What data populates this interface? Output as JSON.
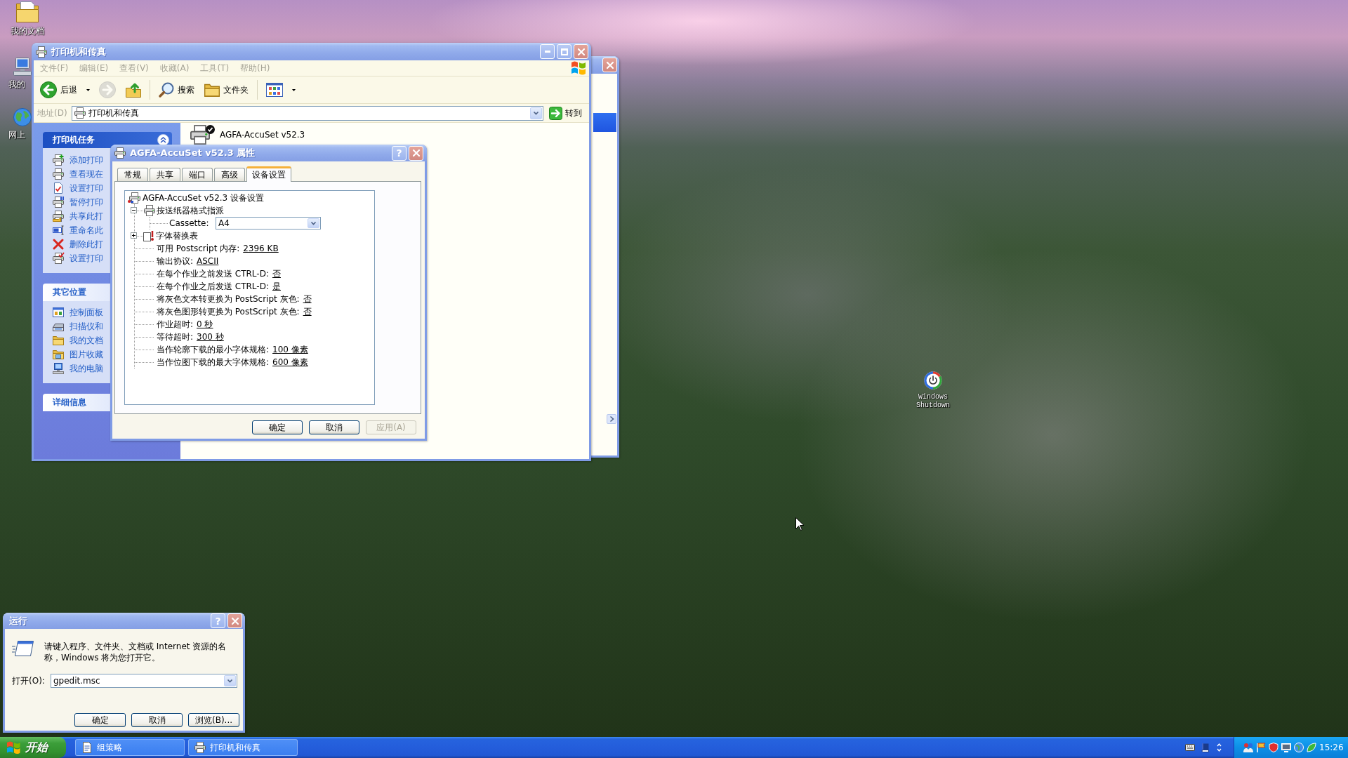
{
  "desktop": {
    "icons": [
      {
        "kind": "documents",
        "label": "我的文档"
      },
      {
        "kind": "computer",
        "label": "我的"
      },
      {
        "kind": "network",
        "label": "网上"
      },
      {
        "kind": "shutdown",
        "label": "Windows Shutdown"
      }
    ]
  },
  "printers_window": {
    "title": "打印机和传真",
    "active": false,
    "menu": [
      "文件(F)",
      "编辑(E)",
      "查看(V)",
      "收藏(A)",
      "工具(T)",
      "帮助(H)"
    ],
    "toolbar": [
      [
        {
          "kind": "back",
          "label": "后退",
          "disabled": false
        },
        {
          "kind": "forward",
          "disabled": true
        },
        {
          "kind": "up",
          "disabled": false
        }
      ],
      [
        {
          "kind": "search",
          "label": "搜索",
          "disabled": false
        },
        {
          "kind": "folders",
          "label": "文件夹",
          "disabled": false
        }
      ],
      [
        {
          "kind": "views",
          "disabled": false
        }
      ]
    ],
    "address": {
      "label": "地址(D)",
      "value": "打印机和传真",
      "go": "转到"
    },
    "sidebar": [
      {
        "kind": "special",
        "title": "打印机任务",
        "expanded": true,
        "items": [
          {
            "kind": "add",
            "label": "添加打印"
          },
          {
            "kind": "queue",
            "label": "查看现在"
          },
          {
            "kind": "document",
            "label": "设置打印"
          },
          {
            "kind": "pause",
            "label": "暂停打印"
          },
          {
            "kind": "share",
            "label": "共享此打"
          },
          {
            "kind": "rename",
            "label": "重命名此"
          },
          {
            "kind": "delete",
            "label": "删除此打"
          },
          {
            "kind": "printer",
            "label": "设置打印"
          }
        ]
      },
      {
        "kind": "normal",
        "title": "其它位置",
        "items": [
          {
            "kind": "panel",
            "label": "控制面板"
          },
          {
            "kind": "scanner",
            "label": "扫描仪和"
          },
          {
            "kind": "folder",
            "label": "我的文档"
          },
          {
            "kind": "pictures",
            "label": "图片收藏"
          },
          {
            "kind": "computer",
            "label": "我的电脑"
          }
        ]
      },
      {
        "kind": "normal",
        "title": "详细信息"
      }
    ],
    "printers": [
      {
        "name": "AGFA-AccuSet v52.3",
        "default": true
      }
    ]
  },
  "properties_dialog": {
    "title": "AGFA-AccuSet v52.3 属性",
    "active": false,
    "help_button": "?",
    "tabs": [
      {
        "label": "常规",
        "selected": false
      },
      {
        "label": "共享",
        "selected": false
      },
      {
        "label": "端口",
        "selected": false
      },
      {
        "label": "高级",
        "selected": false
      },
      {
        "label": "设备设置",
        "selected": true
      }
    ],
    "tree": {
      "label": "AGFA-AccuSet v52.3 设备设置",
      "children": [
        {
          "kind": "tray",
          "label": "按送纸器格式指派",
          "expanded": true,
          "children": [
            {
              "kind": "combo",
              "label": "Cassette:",
              "value": "A4"
            }
          ]
        },
        {
          "kind": "fonts",
          "label": "字体替换表",
          "expanded": false
        },
        {
          "kind": "setting",
          "label": "可用 Postscript 内存:",
          "value": "2396 KB"
        },
        {
          "kind": "setting",
          "label": "输出协议:",
          "value": "ASCII"
        },
        {
          "kind": "setting",
          "label": "在每个作业之前发送 CTRL-D:",
          "value": "否"
        },
        {
          "kind": "setting",
          "label": "在每个作业之后发送 CTRL-D:",
          "value": "是"
        },
        {
          "kind": "setting",
          "label": "将灰色文本转更换为 PostScript 灰色:",
          "value": "否"
        },
        {
          "kind": "setting",
          "label": "将灰色图形转更换为 PostScript 灰色:",
          "value": "否"
        },
        {
          "kind": "setting",
          "label": "作业超时:",
          "value": "0 秒"
        },
        {
          "kind": "setting",
          "label": "等待超时:",
          "value": "300 秒"
        },
        {
          "kind": "setting",
          "label": "当作轮廓下载的最小字体规格:",
          "value": "100 像素"
        },
        {
          "kind": "setting",
          "label": "当作位图下载的最大字体规格:",
          "value": "600 像素"
        }
      ]
    },
    "buttons": [
      {
        "label": "确定",
        "disabled": false
      },
      {
        "label": "取消",
        "disabled": false
      },
      {
        "label": "应用(A)",
        "disabled": true
      }
    ]
  },
  "run_dialog": {
    "title": "运行",
    "active": false,
    "help_button": "?",
    "prompt": "请键入程序、文件夹、文档或 Internet 资源的名称，Windows 将为您打开它。",
    "open_label": "打开(O):",
    "command": "gpedit.msc",
    "buttons": [
      {
        "label": "确定",
        "disabled": false
      },
      {
        "label": "取消",
        "disabled": false
      },
      {
        "label": "浏览(B)...",
        "disabled": false
      }
    ]
  },
  "taskbar": {
    "start": "开始",
    "tasks": [
      {
        "kind": "policy",
        "label": "组策略",
        "selected": false
      },
      {
        "kind": "printer",
        "label": "打印机和传真",
        "selected": false
      }
    ],
    "clock": "15:26"
  }
}
